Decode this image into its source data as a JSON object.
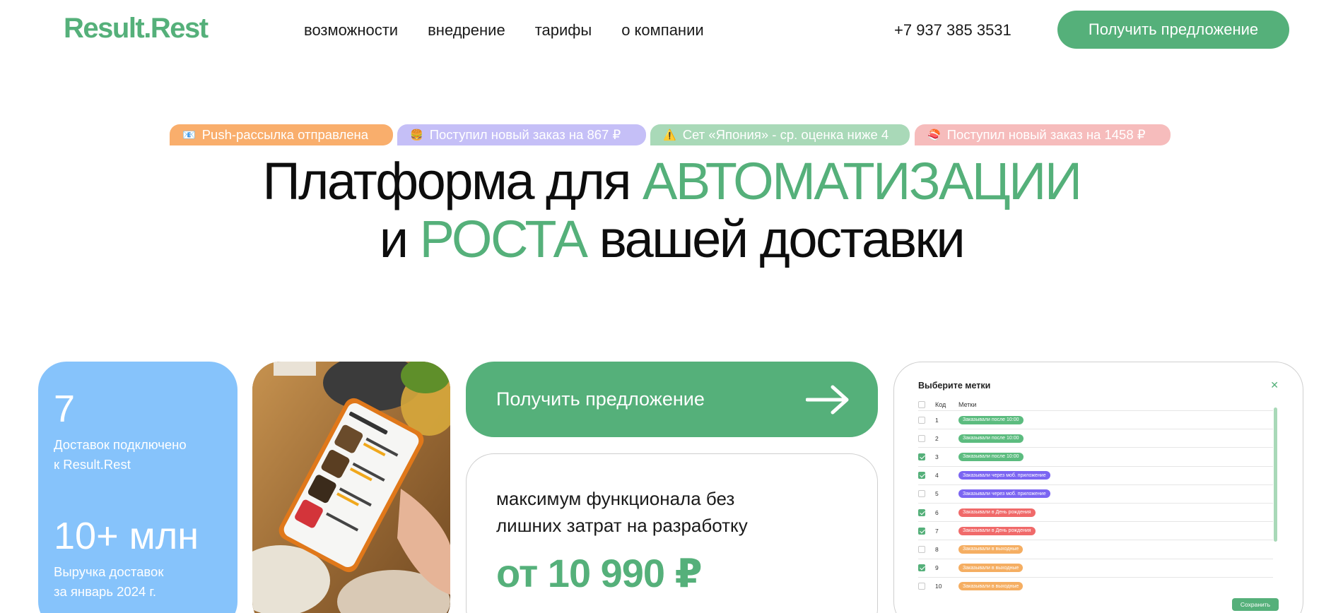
{
  "header": {
    "logo": "Result.Rest",
    "nav": [
      "возможности",
      "внедрение",
      "тарифы",
      "о компании"
    ],
    "phone": "+7 937 385 3531",
    "cta": "Получить предложение"
  },
  "notifications": [
    {
      "icon": "📧",
      "text": "Push-рассылка отправлена",
      "color": "#f9ae6c"
    },
    {
      "icon": "🍔",
      "text": "Поступил новый заказ на 867 ₽",
      "color": "#c5bff7"
    },
    {
      "icon": "⚠️",
      "text": "Сет «Япония» - ср. оценка ниже 4",
      "color": "#a9d9b8"
    },
    {
      "icon": "🍣",
      "text": "Поступил новый заказ на 1458 ₽",
      "color": "#f6bcbc"
    }
  ],
  "headline": {
    "line1_plain": "Платформа для ",
    "line1_accent": "АВТОМАТИЗАЦИИ",
    "line2_plain_start": "и ",
    "line2_accent": "РОСТА",
    "line2_plain_end": " вашей доставки"
  },
  "stats": [
    {
      "value": "7",
      "label_line1": "Доставок подключено",
      "label_line2": "к Result.Rest"
    },
    {
      "value": "10+ млн",
      "label_line1": "Выручка доставок",
      "label_line2": "за январь 2024 г."
    }
  ],
  "cta_card": {
    "label": "Получить предложение"
  },
  "price_card": {
    "desc_line1": "максимум функционала без",
    "desc_line2": "лишних затрат на разработку",
    "price": "от 10 990 ₽"
  },
  "tags_modal": {
    "title": "Выберите метки",
    "col_code": "Код",
    "col_tags": "Метки",
    "rows": [
      {
        "code": "1",
        "checked": false,
        "tag": "Заказывали после 10:00",
        "color": "green"
      },
      {
        "code": "2",
        "checked": false,
        "tag": "Заказывали после 10:00",
        "color": "green"
      },
      {
        "code": "3",
        "checked": true,
        "tag": "Заказывали после 10:00",
        "color": "green"
      },
      {
        "code": "4",
        "checked": true,
        "tag": "Заказывали через моб. приложение",
        "color": "violet"
      },
      {
        "code": "5",
        "checked": false,
        "tag": "Заказывали через моб. приложение",
        "color": "violet"
      },
      {
        "code": "6",
        "checked": true,
        "tag": "Заказывали в День рождения",
        "color": "red"
      },
      {
        "code": "7",
        "checked": true,
        "tag": "Заказывали в День рождения",
        "color": "red"
      },
      {
        "code": "8",
        "checked": false,
        "tag": "Заказывали в выходные",
        "color": "orange"
      },
      {
        "code": "9",
        "checked": true,
        "tag": "Заказывали в выходные",
        "color": "orange"
      },
      {
        "code": "10",
        "checked": false,
        "tag": "Заказывали в выходные",
        "color": "orange"
      }
    ],
    "save": "Сохранить"
  },
  "colors": {
    "brand": "#55b07a",
    "stats_card": "#86c3fb"
  }
}
